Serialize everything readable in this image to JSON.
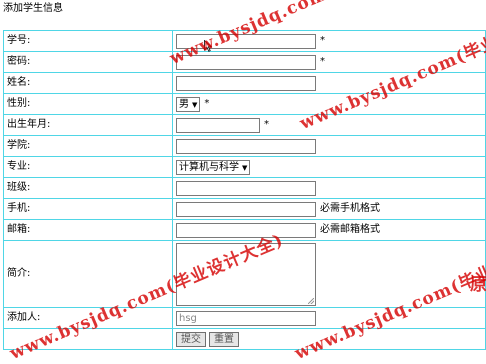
{
  "page_title": "添加学生信息",
  "form": {
    "student_id": {
      "label": "学号:",
      "value": "",
      "required_mark": "*"
    },
    "password": {
      "label": "密码:",
      "value": "",
      "required_mark": "*"
    },
    "name": {
      "label": "姓名:",
      "value": ""
    },
    "gender": {
      "label": "性别:",
      "selected": "男",
      "required_mark": "*"
    },
    "birth_date": {
      "label": "出生年月:",
      "value": "",
      "required_mark": "*"
    },
    "college": {
      "label": "学院:",
      "value": ""
    },
    "major": {
      "label": "专业:",
      "selected": "计算机与科学"
    },
    "class": {
      "label": "班级:",
      "value": ""
    },
    "phone": {
      "label": "手机:",
      "value": "",
      "hint": "必需手机格式"
    },
    "email": {
      "label": "邮箱:",
      "value": "",
      "hint": "必需邮箱格式"
    },
    "intro": {
      "label": "简介:",
      "value": ""
    },
    "added_by": {
      "label": "添加人:",
      "value": "hsg"
    }
  },
  "buttons": {
    "submit": "提交",
    "reset": "重置"
  },
  "watermark": {
    "text": "www.bysjdq.com(毕业设计大全)",
    "partial_char": "原",
    "color": "#d50000"
  },
  "icons": {
    "cursor": "mouse-pointer-icon"
  }
}
